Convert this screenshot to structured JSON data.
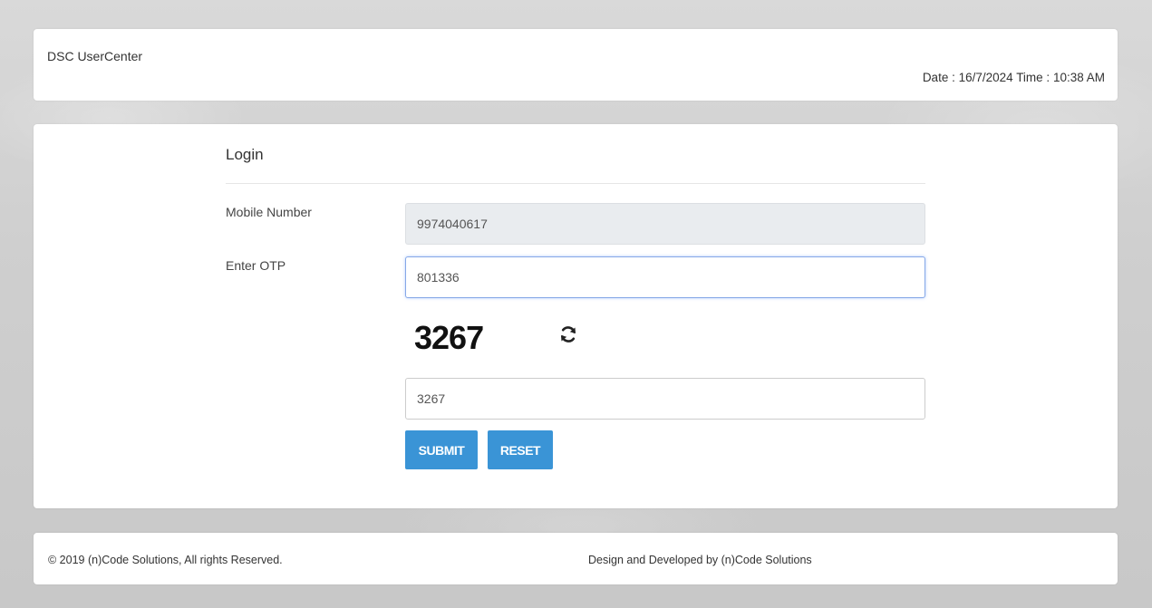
{
  "header": {
    "app_title": "DSC UserCenter",
    "date_label": "Date :",
    "date_value": "16/7/2024",
    "time_label": "Time :",
    "time_value": "10:38 AM"
  },
  "login": {
    "title": "Login",
    "mobile_label": "Mobile Number",
    "mobile_value": "9974040617",
    "otp_label": "Enter OTP",
    "otp_value": "801336",
    "captcha_text": "3267",
    "captcha_input_value": "3267",
    "submit_label": "SUBMIT",
    "reset_label": "RESET"
  },
  "footer": {
    "copyright": "© 2019 (n)Code Solutions, All rights Reserved.",
    "credit": "Design and Developed by (n)Code Solutions"
  },
  "icons": {
    "refresh": "refresh-icon"
  },
  "colors": {
    "button": "#3a94d6",
    "readonly_field": "#e9ecef",
    "focus_border": "#86a8e7"
  }
}
